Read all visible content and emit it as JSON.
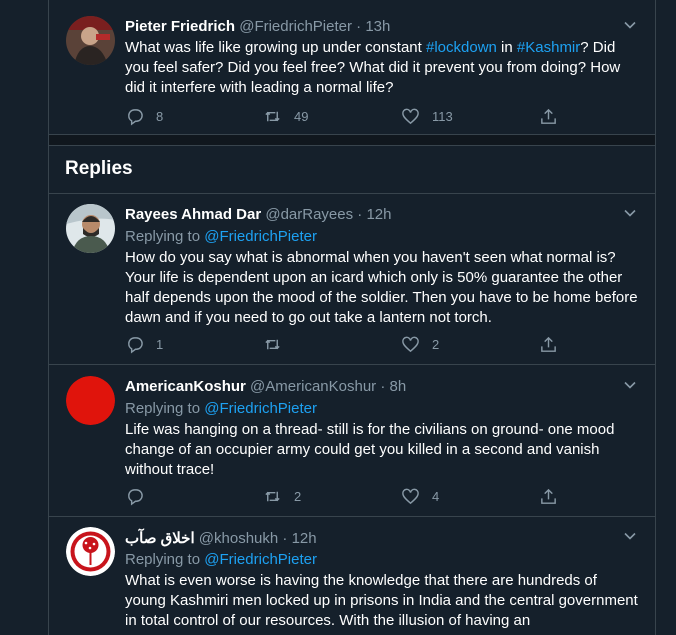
{
  "original": {
    "name": "Pieter Friedrich",
    "handle": "@FriedrichPieter",
    "time": "13h",
    "text_1": "What was life like growing up under constant ",
    "tag_1": "#lockdown",
    "text_2": " in ",
    "tag_2": "#Kashmir",
    "text_3": "? Did you feel safer? Did you feel free? What did it prevent you from doing? How did it interfere with leading a normal life?",
    "reply_count": "8",
    "retweet_count": "49",
    "like_count": "113"
  },
  "replies_heading": "Replies",
  "replies": [
    {
      "name": "Rayees Ahmad Dar",
      "handle": "@darRayees",
      "time": "12h",
      "replying_label": "Replying to",
      "replying_to": "@FriedrichPieter",
      "text": "How do you say what is abnormal when you haven't seen what normal is? Your life is dependent upon an icard which only is 50% guarantee the other half depends upon the mood of the soldier. Then you have to be home before dawn and if you need to go out take a lantern not torch.",
      "reply_count": "1",
      "retweet_count": "",
      "like_count": "2"
    },
    {
      "name": "AmericanKoshur",
      "handle": "@AmericanKoshur",
      "time": "8h",
      "replying_label": "Replying to",
      "replying_to": "@FriedrichPieter",
      "text": "Life was hanging on a thread- still is for the civilians on ground- one mood change of an occupier army could get you killed in a second and vanish without trace!",
      "reply_count": "",
      "retweet_count": "2",
      "like_count": "4"
    },
    {
      "name": "اخلاق صآب",
      "handle": "@khoshukh",
      "time": "12h",
      "replying_label": "Replying to",
      "replying_to": "@FriedrichPieter",
      "text": "What is even worse is having the knowledge that there are hundreds of young Kashmiri men locked up in prisons in India and the central government in total control of our resources. With the illusion of having an"
    }
  ],
  "colors": {
    "background": "#15202b",
    "border": "#38444d",
    "muted": "#8899a6",
    "link": "#1da1f2",
    "avatar_red": "#e0140c"
  },
  "icons": [
    "reply-icon",
    "retweet-icon",
    "like-icon",
    "share-icon",
    "chevron-down-icon"
  ]
}
